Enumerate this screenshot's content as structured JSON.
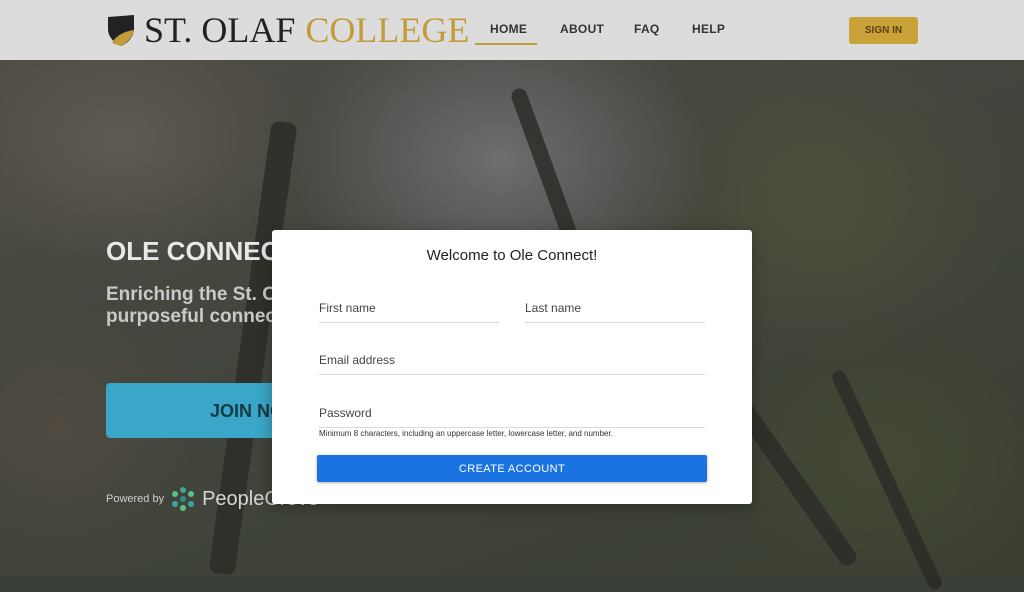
{
  "brand": {
    "name_part1": "ST. OLAF",
    "name_part2": "COLLEGE",
    "accent_color": "#c39b3b"
  },
  "nav": {
    "items": [
      {
        "label": "HOME",
        "active": true
      },
      {
        "label": "ABOUT",
        "active": false
      },
      {
        "label": "FAQ",
        "active": false
      },
      {
        "label": "HELP",
        "active": false
      }
    ],
    "sign_in_label": "SIGN IN"
  },
  "hero": {
    "title": "OLE CONNECT",
    "subtitle": "Enriching the St. Olaf community through purposeful connections.",
    "join_label": "JOIN NOW",
    "powered_by": "Powered by",
    "provider": "PeopleGrove"
  },
  "modal": {
    "title": "Welcome to Ole Connect!",
    "first_name_placeholder": "First name",
    "last_name_placeholder": "Last name",
    "email_placeholder": "Email address",
    "password_placeholder": "Password",
    "password_hint": "Minimum 8 characters, including an uppercase letter, lowercase letter, and number.",
    "create_account_label": "CREATE ACCOUNT",
    "button_color": "#1a73e0"
  }
}
